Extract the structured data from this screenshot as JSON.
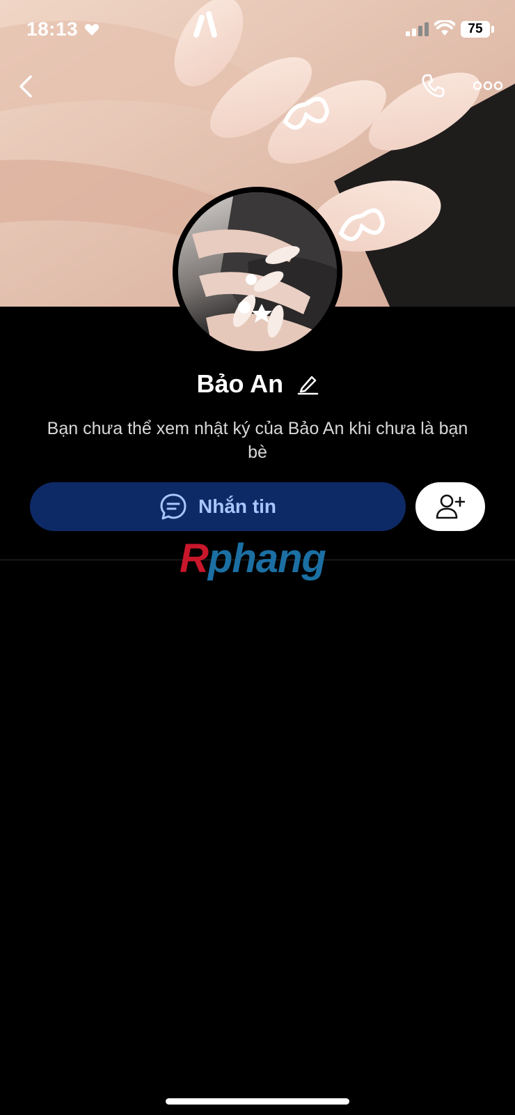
{
  "status_bar": {
    "time": "18:13",
    "battery": "75"
  },
  "profile": {
    "name": "Bảo An",
    "privacy_note": "Bạn chưa thể xem nhật ký của Bảo An khi chưa là bạn bè"
  },
  "actions": {
    "message_label": "Nhắn tin"
  },
  "watermark": {
    "first_letter": "R",
    "rest": "phang"
  },
  "icons": {
    "back": "chevron-left-icon",
    "call": "phone-icon",
    "more": "more-horizontal-icon",
    "edit": "pencil-icon",
    "message": "chat-bubble-icon",
    "add_friend": "add-user-icon"
  },
  "colors": {
    "background": "#000000",
    "message_button_bg": "#0e2a66",
    "message_button_text": "#a9c6ff",
    "divider": "#2c2c2e"
  }
}
